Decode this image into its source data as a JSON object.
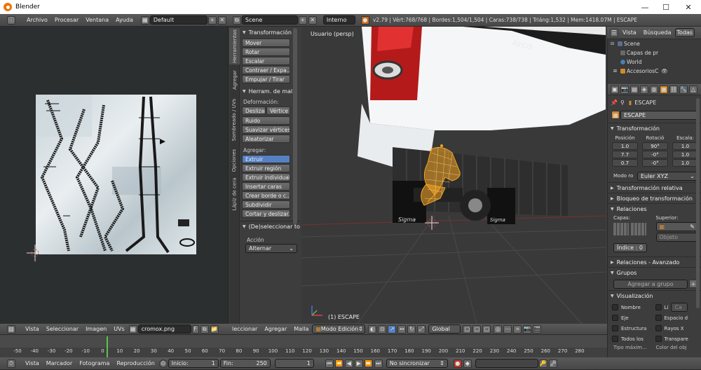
{
  "window": {
    "title": "Blender"
  },
  "info_bar": {
    "menus": [
      "Archivo",
      "Procesar",
      "Ventana",
      "Ayuda"
    ],
    "layout": "Default",
    "scene": "Scene",
    "engine": "Interno",
    "stats": "v2.79 | Vért:768/768 | Bordes:1,504/1,504 | Caras:738/738 | Triáng:1,532 | Mem:1418.07M | ESCAPE"
  },
  "tool_tabs": [
    "Herramientas",
    "Agregar",
    "Sombreado / UVs",
    "Opciones",
    "Lápiz de cera"
  ],
  "tool_panel": {
    "transform_header": "Transformación",
    "transform_buttons": [
      "Mover",
      "Rotar",
      "Escalar",
      "Contraer / Expa...",
      "Empujar / Tirar"
    ],
    "mesh_tools_header": "Herram. de malla",
    "deform_label": "Deformación:",
    "deform_row": [
      "Deslizar",
      "Vértice"
    ],
    "deform_buttons": [
      "Ruido",
      "Suavizar vértices",
      "Aleatorizar"
    ],
    "add_label": "Agregar:",
    "add_selected": "Extruir",
    "add_buttons": [
      "Extruir región",
      "Extruir individual",
      "Insertar caras",
      "Crear borde o c...",
      "Subdividir",
      "Cortar y deslizar..."
    ],
    "deselect_header": "(De)seleccionar todo",
    "action_label": "Acción",
    "action_value": "Alternar"
  },
  "viewport": {
    "label": "Usuario (persp)",
    "object_label": "(1) ESCAPE",
    "brand_text_1": "Sigma",
    "brand_text_2": "Sigma",
    "truck_text": "AYCO"
  },
  "uv_header": {
    "menus": [
      "Vista",
      "Seleccionar",
      "Imagen",
      "UVs"
    ],
    "image": "cromox.png",
    "f_flag": "F"
  },
  "view3d_header": {
    "menus": [
      "leccionar",
      "Agregar",
      "Malla"
    ],
    "mode": "Modo Edición",
    "orientation": "Global"
  },
  "outliner": {
    "menus": [
      "Vista",
      "Búsqueda",
      "Todas"
    ],
    "items": [
      "Scene",
      "Capas de pr",
      "World",
      "AccesoriosC"
    ]
  },
  "properties": {
    "breadcrumb": "ESCAPE",
    "object_name": "ESCAPE",
    "transform_header": "Transformación",
    "col_headers": [
      "Posición",
      "Rotació",
      "Escala:"
    ],
    "location": [
      "1.0",
      "7.7",
      "0.7"
    ],
    "rotation": [
      "90°",
      "-0°",
      "-0°"
    ],
    "scale": [
      "1.0",
      "1.0",
      "1.0"
    ],
    "rot_mode_label": "Modo ro",
    "rot_mode": "Euler XYZ",
    "delta_header": "Transformación relativa",
    "lock_header": "Bloqueo de transformación",
    "relations_header": "Relaciones",
    "layers_label": "Capas:",
    "parent_label": "Superior:",
    "parent_type": "Objeto",
    "index": "Índice : 0",
    "relations_ext_header": "Relaciones - Avanzado",
    "groups_header": "Grupos",
    "add_group": "Agregar a grupo",
    "display_header": "Visualización",
    "display_left": [
      "Nombre",
      "Eje",
      "Estructura",
      "Todos los"
    ],
    "display_right": [
      "Lí",
      "Espacio d",
      "Rayos X",
      "Transpare"
    ],
    "display_right_box": "Ca",
    "footer_left": "Tipo máxim...",
    "footer_right": "Color del obj"
  },
  "timeline": {
    "ticks": [
      "-50",
      "-40",
      "-30",
      "-20",
      "-10",
      "0",
      "10",
      "20",
      "30",
      "40",
      "50",
      "60",
      "70",
      "80",
      "90",
      "100",
      "110",
      "120",
      "130",
      "140",
      "150",
      "160",
      "170",
      "180",
      "190",
      "200",
      "210",
      "220",
      "230",
      "240",
      "250",
      "260",
      "270",
      "280"
    ],
    "menus": [
      "Vista",
      "Marcador",
      "Fotograma",
      "Reproducción"
    ],
    "start": "Inicio:",
    "start_val": "1",
    "end": "Fin:",
    "end_val": "250",
    "current": "1",
    "sync": "No sincronizar"
  },
  "colors": {
    "accent_blue": "#5680c2",
    "selection_orange": "#f5a623",
    "viewport_bg": "#393939",
    "uv_bg": "#2c2f2f"
  }
}
